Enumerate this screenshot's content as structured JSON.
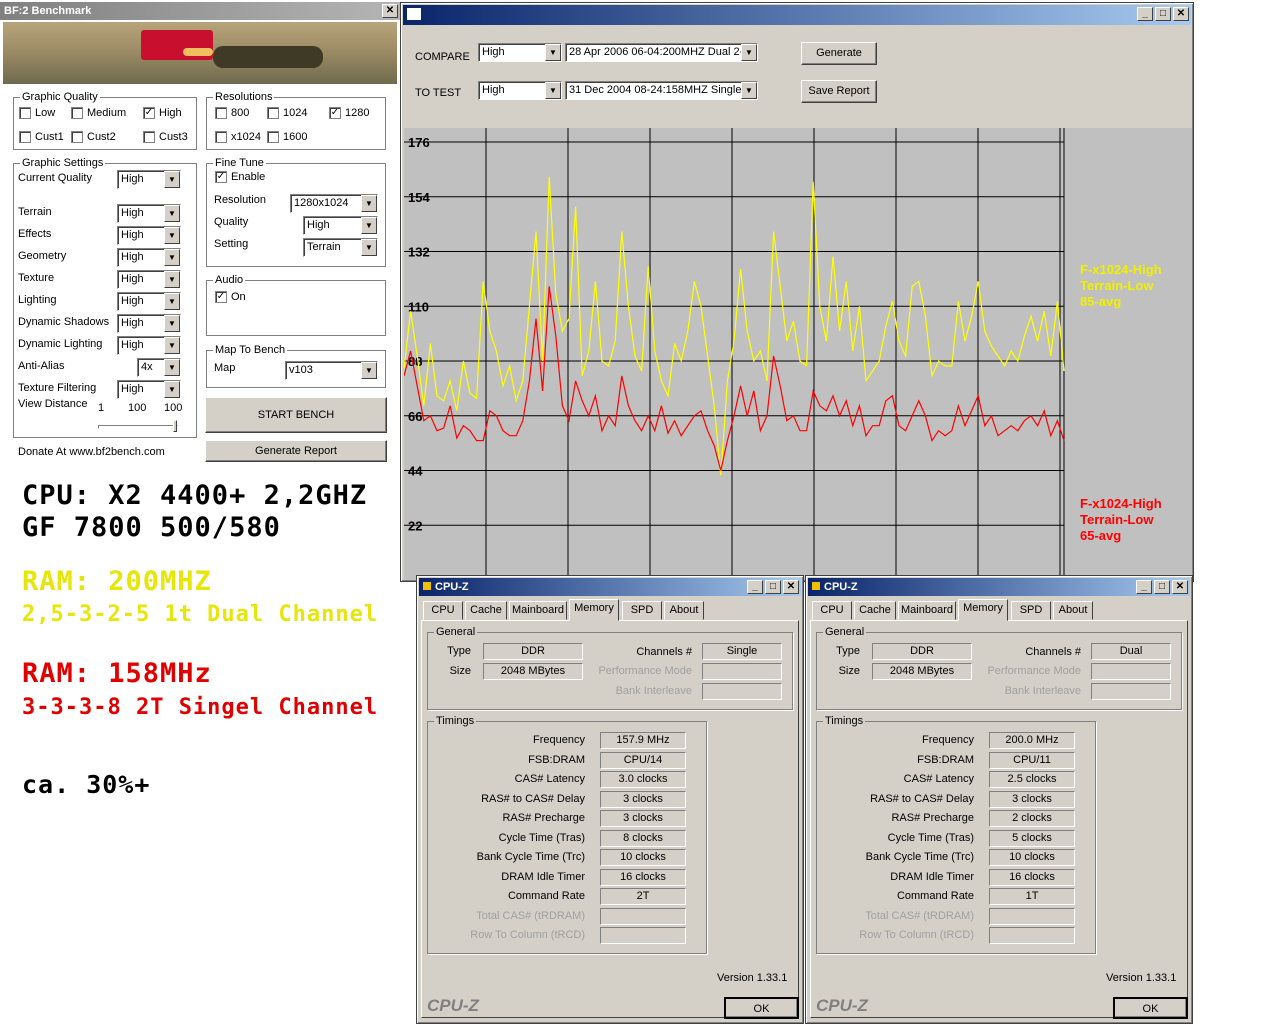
{
  "bf2": {
    "title": "BF:2 Benchmark",
    "graphic_quality": {
      "title": "Graphic Quality",
      "options": [
        {
          "label": "Low",
          "checked": false
        },
        {
          "label": "Medium",
          "checked": false
        },
        {
          "label": "High",
          "checked": true
        },
        {
          "label": "Cust1",
          "checked": false
        },
        {
          "label": "Cust2",
          "checked": false
        },
        {
          "label": "Cust3",
          "checked": false
        }
      ]
    },
    "resolutions": {
      "title": "Resolutions",
      "options": [
        {
          "label": "800",
          "checked": false
        },
        {
          "label": "1024",
          "checked": false
        },
        {
          "label": "1280",
          "checked": true
        },
        {
          "label": "x1024",
          "checked": false
        },
        {
          "label": "1600",
          "checked": false
        }
      ]
    },
    "graphic_settings": {
      "title": "Graphic Settings",
      "rows": [
        {
          "label": "Current Quality",
          "value": "High"
        },
        {
          "label": "Terrain",
          "value": "High"
        },
        {
          "label": "Effects",
          "value": "High"
        },
        {
          "label": "Geometry",
          "value": "High"
        },
        {
          "label": "Texture",
          "value": "High"
        },
        {
          "label": "Lighting",
          "value": "High"
        },
        {
          "label": "Dynamic Shadows",
          "value": "High"
        },
        {
          "label": "Dynamic Lighting",
          "value": "High"
        },
        {
          "label": "Anti-Alias",
          "value": "4x"
        },
        {
          "label": "Texture Filtering",
          "value": "High"
        }
      ],
      "view_distance": {
        "label": "View Distance",
        "min": "1",
        "mid": "100",
        "max": "100"
      }
    },
    "fine_tune": {
      "title": "Fine Tune",
      "enable_label": "Enable",
      "enabled": true,
      "rows": [
        {
          "label": "Resolution",
          "value": "1280x1024"
        },
        {
          "label": "Quality",
          "value": "High"
        },
        {
          "label": "Setting",
          "value": "Terrain"
        }
      ]
    },
    "audio": {
      "title": "Audio",
      "on_label": "On",
      "on": true
    },
    "map": {
      "title": "Map To Bench",
      "label": "Map",
      "value": "v103"
    },
    "start_label": "START BENCH",
    "report_label": "Generate Report",
    "donate": "Donate At www.bf2bench.com"
  },
  "overlay": {
    "cpu": "CPU: X2 4400+ 2,2GHZ",
    "gpu": "GF 7800 500/580",
    "ram1_a": "RAM: 200MHZ",
    "ram1_b": "2,5-3-2-5 1t Dual Channel",
    "ram2_a": "RAM: 158MHz",
    "ram2_b": "3-3-3-8 2T Singel Channel",
    "gain": "ca. 30%+"
  },
  "compare": {
    "compare_label": "COMPARE",
    "totest_label": "TO TEST",
    "compare_quality": "High",
    "compare_run": "28 Apr 2006 06-04:200MHZ Dual 2-",
    "totest_quality": "High",
    "totest_run": "31 Dec 2004 08-24:158MHZ Single",
    "generate_label": "Generate",
    "save_label": "Save Report"
  },
  "chart_data": {
    "type": "line",
    "ylim": [
      0,
      176
    ],
    "yticks": [
      "176",
      "154",
      "132",
      "110",
      "88",
      "66",
      "44",
      "22"
    ],
    "series": [
      {
        "name": "F-x1024-High Terrain-Low 85-avg",
        "color": "#ffff00",
        "values": [
          85,
          108,
          90,
          70,
          95,
          74,
          72,
          80,
          68,
          88,
          75,
          73,
          120,
          100,
          92,
          78,
          86,
          72,
          80,
          110,
          140,
          88,
          162,
          115,
          100,
          105,
          150,
          82,
          92,
          120,
          88,
          86,
          96,
          140,
          110,
          90,
          84,
          126,
          92,
          80,
          74,
          95,
          88,
          100,
          120,
          110,
          90,
          70,
          42,
          80,
          96,
          125,
          100,
          88,
          92,
          80,
          140,
          118,
          96,
          104,
          88,
          86,
          160,
          110,
          96,
          130,
          100,
          120,
          92,
          110,
          80,
          84,
          88,
          102,
          112,
          96,
          90,
          118,
          120,
          106,
          82,
          88,
          86,
          86,
          112,
          96,
          106,
          120,
          100,
          94,
          90,
          86,
          92,
          88,
          98,
          106,
          96,
          108,
          90,
          112,
          84
        ]
      },
      {
        "name": "F-x1024-High Terrain-Low 65-avg",
        "color": "#ff0000",
        "values": [
          82,
          92,
          78,
          64,
          66,
          60,
          61,
          70,
          57,
          62,
          60,
          56,
          56,
          68,
          66,
          60,
          58,
          58,
          64,
          80,
          105,
          76,
          118,
          98,
          70,
          64,
          80,
          72,
          66,
          74,
          60,
          66,
          62,
          82,
          70,
          64,
          60,
          66,
          60,
          70,
          59,
          64,
          58,
          62,
          66,
          68,
          60,
          54,
          44,
          56,
          66,
          78,
          66,
          76,
          60,
          66,
          90,
          78,
          64,
          66,
          60,
          60,
          76,
          70,
          68,
          74,
          66,
          72,
          62,
          70,
          58,
          62,
          62,
          72,
          74,
          62,
          60,
          66,
          72,
          66,
          56,
          60,
          58,
          60,
          70,
          62,
          68,
          74,
          62,
          66,
          58,
          60,
          62,
          60,
          64,
          66,
          62,
          68,
          58,
          64,
          56
        ]
      }
    ]
  },
  "cpuz_left": {
    "title": "CPU-Z",
    "tabs": [
      "CPU",
      "Cache",
      "Mainboard",
      "Memory",
      "SPD",
      "About"
    ],
    "active_tab": 3,
    "general_title": "General",
    "type_label": "Type",
    "type": "DDR",
    "size_label": "Size",
    "size": "2048 MBytes",
    "channels_label": "Channels #",
    "channels": "Single",
    "perf_label": "Performance Mode",
    "bank_label": "Bank Interleave",
    "timings_title": "Timings",
    "timings": [
      {
        "label": "Frequency",
        "value": "157.9 MHz"
      },
      {
        "label": "FSB:DRAM",
        "value": "CPU/14"
      },
      {
        "label": "CAS# Latency",
        "value": "3.0 clocks"
      },
      {
        "label": "RAS# to CAS# Delay",
        "value": "3 clocks"
      },
      {
        "label": "RAS# Precharge",
        "value": "3 clocks"
      },
      {
        "label": "Cycle Time (Tras)",
        "value": "8 clocks"
      },
      {
        "label": "Bank Cycle Time (Trc)",
        "value": "10 clocks"
      },
      {
        "label": "DRAM Idle Timer",
        "value": "16 clocks"
      },
      {
        "label": "Command Rate",
        "value": "2T"
      },
      {
        "label": "Total CAS# (tRDRAM)",
        "value": ""
      },
      {
        "label": "Row To Column (tRCD)",
        "value": ""
      }
    ],
    "version": "Version 1.33.1",
    "brand": "CPU-Z",
    "ok": "OK"
  },
  "cpuz_right": {
    "title": "CPU-Z",
    "tabs": [
      "CPU",
      "Cache",
      "Mainboard",
      "Memory",
      "SPD",
      "About"
    ],
    "active_tab": 3,
    "general_title": "General",
    "type_label": "Type",
    "type": "DDR",
    "size_label": "Size",
    "size": "2048 MBytes",
    "channels_label": "Channels #",
    "channels": "Dual",
    "perf_label": "Performance Mode",
    "bank_label": "Bank Interleave",
    "timings_title": "Timings",
    "timings": [
      {
        "label": "Frequency",
        "value": "200.0 MHz"
      },
      {
        "label": "FSB:DRAM",
        "value": "CPU/11"
      },
      {
        "label": "CAS# Latency",
        "value": "2.5 clocks"
      },
      {
        "label": "RAS# to CAS# Delay",
        "value": "3 clocks"
      },
      {
        "label": "RAS# Precharge",
        "value": "2 clocks"
      },
      {
        "label": "Cycle Time (Tras)",
        "value": "5 clocks"
      },
      {
        "label": "Bank Cycle Time (Trc)",
        "value": "10 clocks"
      },
      {
        "label": "DRAM Idle Timer",
        "value": "16 clocks"
      },
      {
        "label": "Command Rate",
        "value": "1T"
      },
      {
        "label": "Total CAS# (tRDRAM)",
        "value": ""
      },
      {
        "label": "Row To Column (tRCD)",
        "value": ""
      }
    ],
    "version": "Version 1.33.1",
    "brand": "CPU-Z",
    "ok": "OK"
  }
}
